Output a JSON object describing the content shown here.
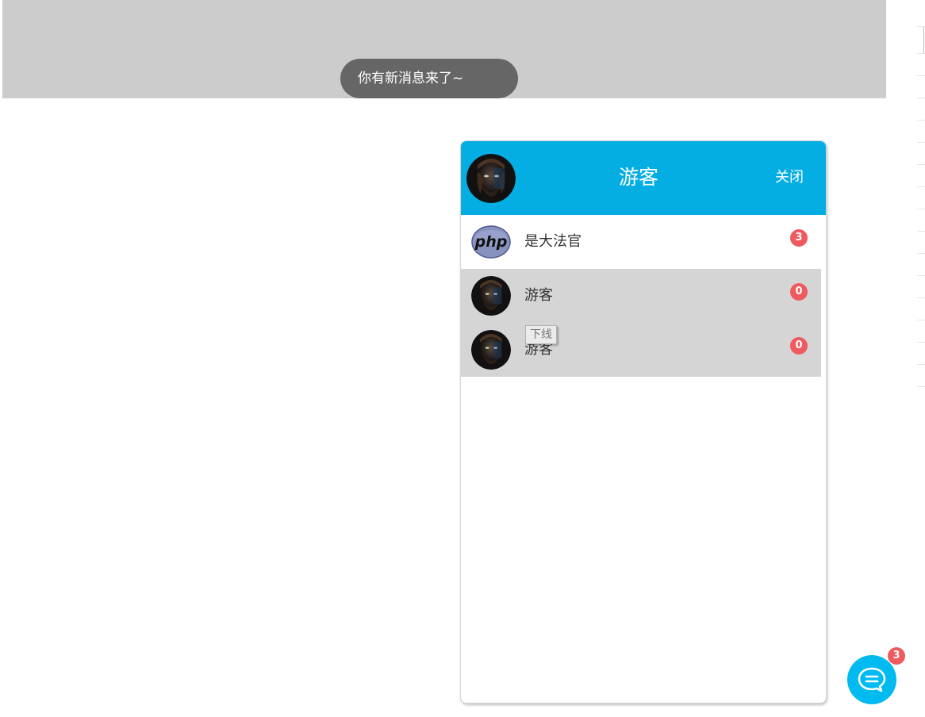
{
  "notification": {
    "toast_text": "你有新消息来了~"
  },
  "chat_panel": {
    "header": {
      "title": "游客",
      "close_label": "关闭",
      "avatar_icon": "bearded-man-avatar"
    },
    "contacts": [
      {
        "name": "是大法官",
        "unread": "3",
        "avatar_icon": "php-logo-avatar",
        "highlighted": false
      },
      {
        "name": "游客",
        "unread": "0",
        "avatar_icon": "bearded-man-avatar",
        "highlighted": true
      },
      {
        "name": "游客",
        "unread": "0",
        "avatar_icon": "bearded-man-avatar",
        "highlighted": true,
        "tooltip": "下线"
      }
    ]
  },
  "chat_button": {
    "icon": "chat-bubble-icon",
    "unread": "3"
  },
  "colors": {
    "header_blue": "#04aee2",
    "fab_blue": "#00baf0",
    "badge_red": "#ee5a5f",
    "banner_grey": "#cccccc",
    "toast_grey": "#666666",
    "row_grey": "#d5d5d5"
  }
}
